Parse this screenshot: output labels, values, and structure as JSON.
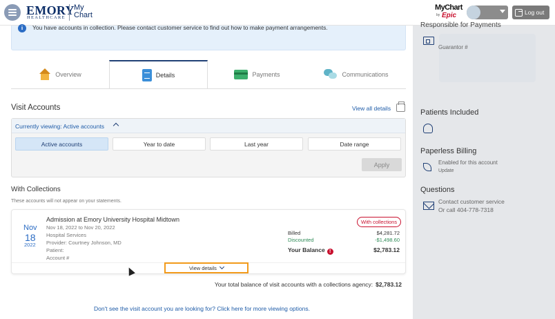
{
  "header": {
    "brand_main": "EMORY",
    "brand_sub": "HEALTHCARE",
    "app_name_1": "My",
    "app_name_2": "Chart",
    "epic_mychart": "MyChart",
    "epic_by": "by",
    "epic_logo": "Epic",
    "logout_label": "Log out"
  },
  "alert": {
    "text": "You have accounts in collection. Please contact customer service to find out how to make payment arrangements."
  },
  "tabs": [
    {
      "label": "Overview",
      "icon": "house-icon"
    },
    {
      "label": "Details",
      "icon": "document-icon",
      "active": true
    },
    {
      "label": "Payments",
      "icon": "credit-card-icon"
    },
    {
      "label": "Communications",
      "icon": "chat-icon"
    }
  ],
  "visit_accounts": {
    "title": "Visit Accounts",
    "view_all_label": "View all details",
    "currently_viewing": "Currently viewing: Active accounts",
    "filters": [
      "Active accounts",
      "Year to date",
      "Last year",
      "Date range"
    ],
    "apply_label": "Apply"
  },
  "collections": {
    "title": "With Collections",
    "note": "These accounts will not appear on your statements.",
    "account": {
      "month": "Nov",
      "day": "18",
      "year": "2022",
      "title": "Admission at Emory University Hospital Midtown",
      "date_range": "Nov 18, 2022 to Nov 20, 2022",
      "service": "Hospital Services",
      "provider": "Provider: Courtney Johnson, MD",
      "patient": "Patient:",
      "account_no": "Account #",
      "badge": "With collections",
      "billed_label": "Billed",
      "billed_value": "$4,281.72",
      "discounted_label": "Discounted",
      "discounted_value": "-$1,498.60",
      "balance_label": "Your Balance",
      "balance_value": "$2,783.12",
      "view_details_label": "View details"
    },
    "total_text": "Your total balance of visit accounts with a collections agency:",
    "total_value": "$2,783.12",
    "bottom_link": "Don't see the visit account you are looking for? Click here for more viewing options."
  },
  "side": {
    "responsible_title": "Responsible for Payments",
    "guarantor_label": "Guarantor #",
    "patients_title": "Patients Included",
    "paperless_title": "Paperless Billing",
    "paperless_status": "Enabled for this account",
    "paperless_update": "Update",
    "questions_title": "Questions",
    "contact_link": "Contact customer service",
    "call_text": "Or call 404-778-7318"
  },
  "colors": {
    "navy": "#1f3f75",
    "link": "#1f5ca8",
    "alert": "#c8102e",
    "highlight": "#f29a1a",
    "green": "#2e8b57"
  }
}
